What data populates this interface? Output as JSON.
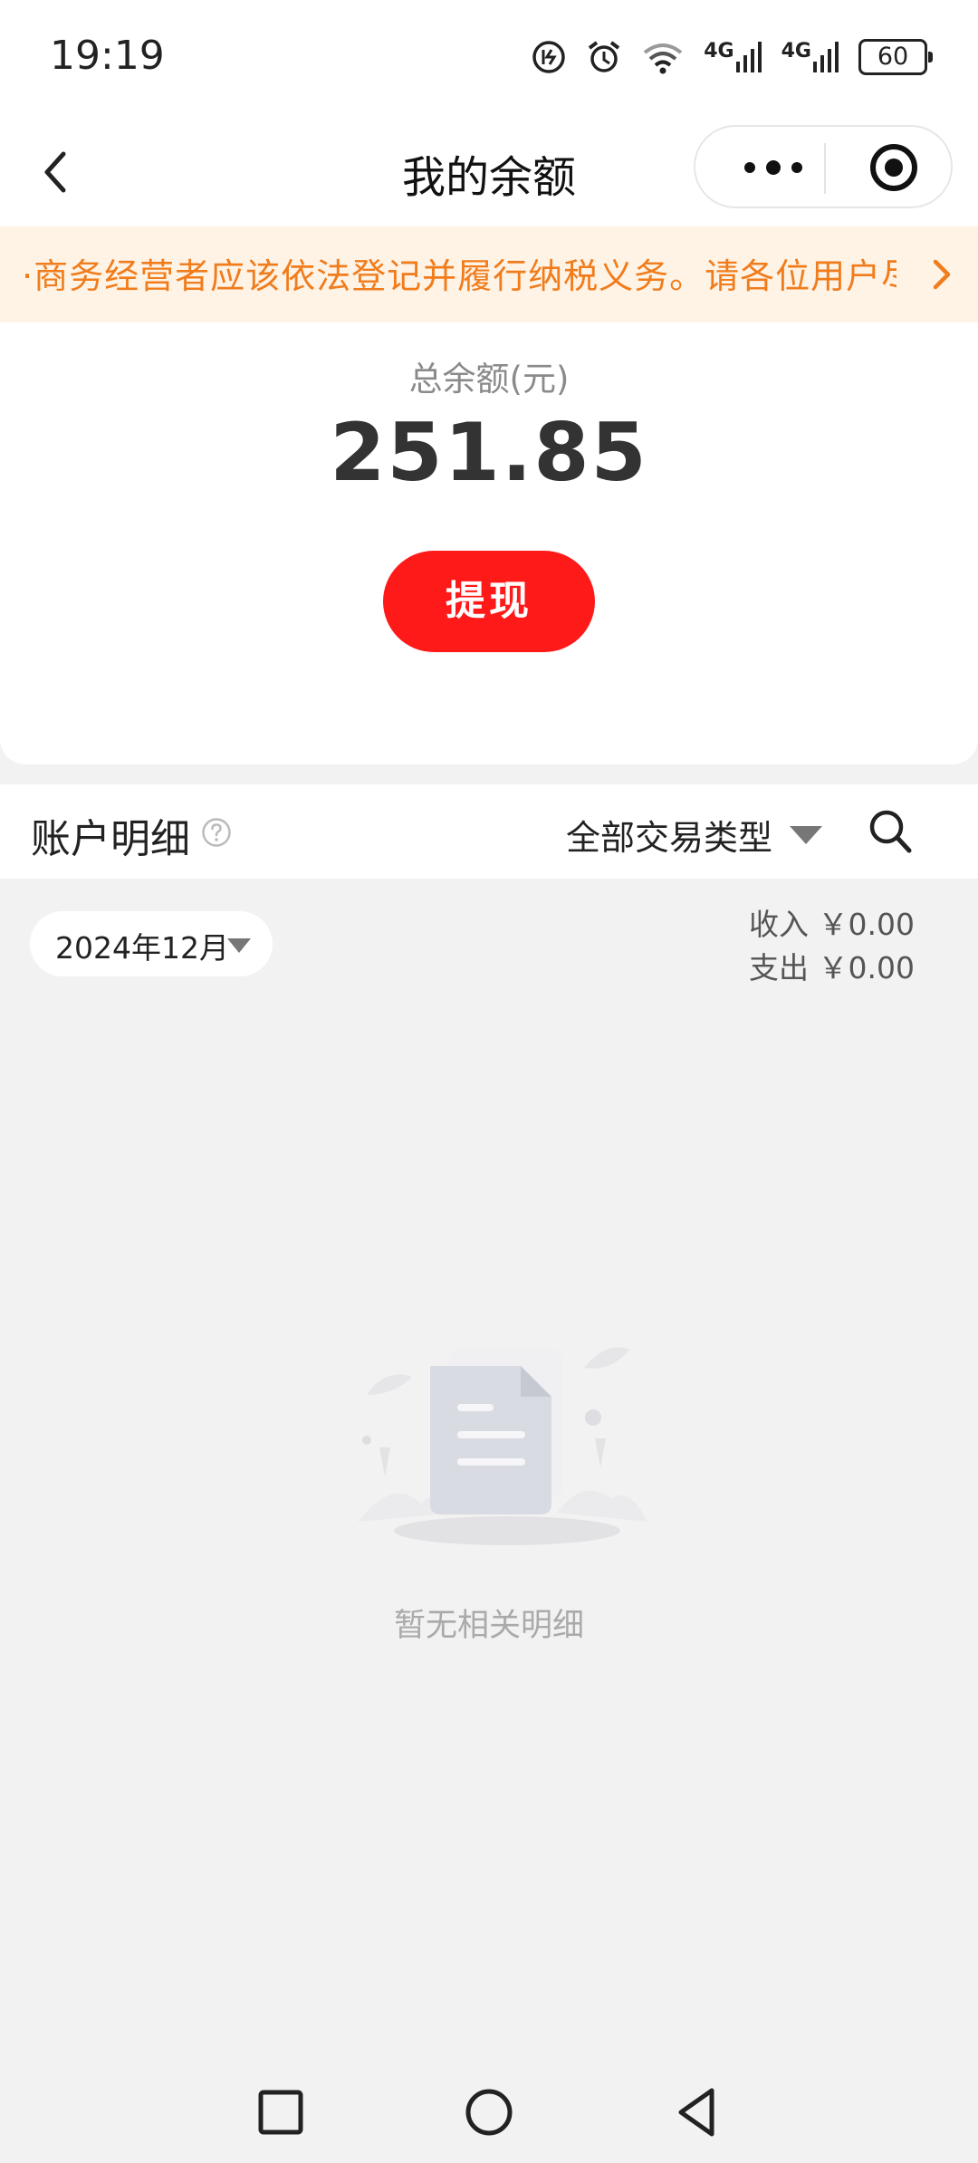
{
  "status_bar": {
    "time": "19:19",
    "battery": "60",
    "signal_1": "4G",
    "signal_2": "4G"
  },
  "nav": {
    "title": "我的余额"
  },
  "notice": {
    "text": "·商务经营者应该依法登记并履行纳税义务。请各位用户尽"
  },
  "balance": {
    "label": "总余额(元)",
    "amount": "251.85",
    "withdraw_label": "提现"
  },
  "detail": {
    "title": "账户明细",
    "type_filter": "全部交易类型"
  },
  "period": {
    "month": "2024年12月",
    "income": "收入 ￥0.00",
    "expense": "支出 ￥0.00"
  },
  "empty": {
    "text": "暂无相关明细"
  },
  "colors": {
    "accent_red": "#ff1a1a",
    "notice_text": "#f07c1c",
    "notice_bg": "#fff3e6"
  }
}
